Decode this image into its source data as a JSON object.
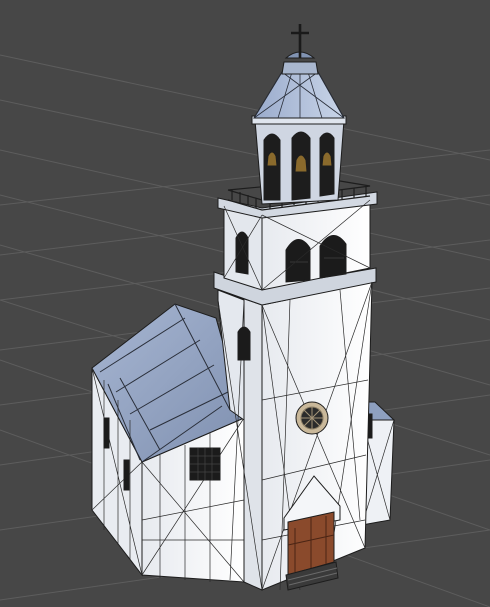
{
  "viewport": {
    "background": "#474747",
    "grid_color": "#5e5e5e",
    "wire_color": "#1c1c1c",
    "wall_color": "#f1f3f6",
    "wall_shade": "#d9dde3",
    "roof_color": "#8ea0c0",
    "roof_light": "#b3c4de",
    "door_color": "#8a4a2c",
    "window_color": "#1b1b1b"
  }
}
